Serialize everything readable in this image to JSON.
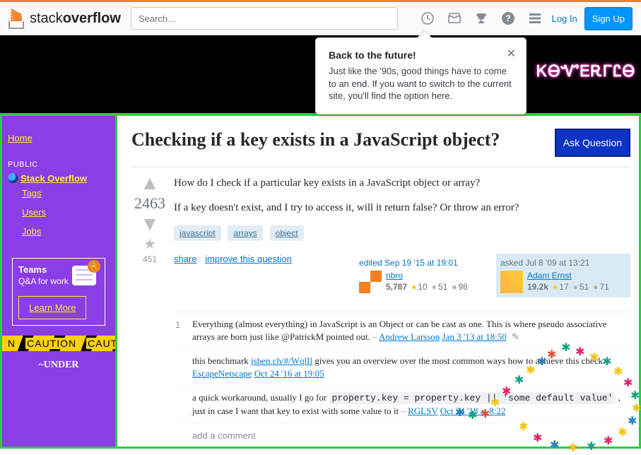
{
  "header": {
    "logo_prefix": "stack",
    "logo_bold": "overflow",
    "search_placeholder": "Search…",
    "login": "Log In",
    "signup": "Sign Up"
  },
  "popover": {
    "title": "Back to the future!",
    "body": "Just like the '90s, good things have to come to an end. If you want to switch to the current site, you'll find the option here."
  },
  "banner": {
    "text": "ᏦᎾᏉᎬᎡᎱᏝᎾ"
  },
  "sidebar": {
    "home": "Home",
    "public": "PUBLIC",
    "so": "Stack Overflow",
    "tags": "Tags",
    "users": "Users",
    "jobs": "Jobs",
    "teams_title": "Teams",
    "teams_sub": "Q&A for work",
    "learn": "Learn More",
    "caution": "CAUTION",
    "under": "~UNDER"
  },
  "question": {
    "title": "Checking if a key exists in a JavaScript object?",
    "ask": "Ask Question",
    "body1": "How do I check if a particular key exists in a JavaScript object or array?",
    "body2": "If a key doesn't exist, and I try to access it, will it return false? Or throw an error?",
    "tags": [
      "javascript",
      "arrays",
      "object"
    ],
    "score": "2463",
    "favcount": "451",
    "share": "share",
    "improve": "improve this question",
    "edited_label": "edited Sep 19 '15 at 19:01",
    "editor_name": "nbro",
    "editor_rep": "5,787",
    "editor_gold": "10",
    "editor_silver": "51",
    "editor_bronze": "98",
    "asked_label": "asked Jul 8 '09 at 13:21",
    "owner_name": "Adam Ernst",
    "owner_rep": "19.2k",
    "owner_gold": "17",
    "owner_silver": "51",
    "owner_bronze": "71"
  },
  "comments": [
    {
      "votes": "1",
      "text": "Everything (almost everything) in JavaScript is an Object or can be cast as one. This is where pseudo associative arrays are born just like @PatrickM pointed out.",
      "user": "Andrew Larsson",
      "when": "Jan 3 '13 at 18:50",
      "pencil": true
    },
    {
      "votes": "",
      "pre": "this benchmark ",
      "link": "jsben.ch/#/WqlIl",
      "post": " gives you an overview over the most common ways how to achieve this check.",
      "user": "EscapeNetscape",
      "when": "Oct 24 '16 at 19:05"
    },
    {
      "votes": "",
      "pre2": "a quick workaround, usually I go for ",
      "code": "property.key = property.key || 'some default value'",
      "post2": " , just in case I want that key to exist with some value to it",
      "user": "RGLSV",
      "when": "Oct 24 '18 at 8:22"
    }
  ],
  "add_comment": "add a comment"
}
